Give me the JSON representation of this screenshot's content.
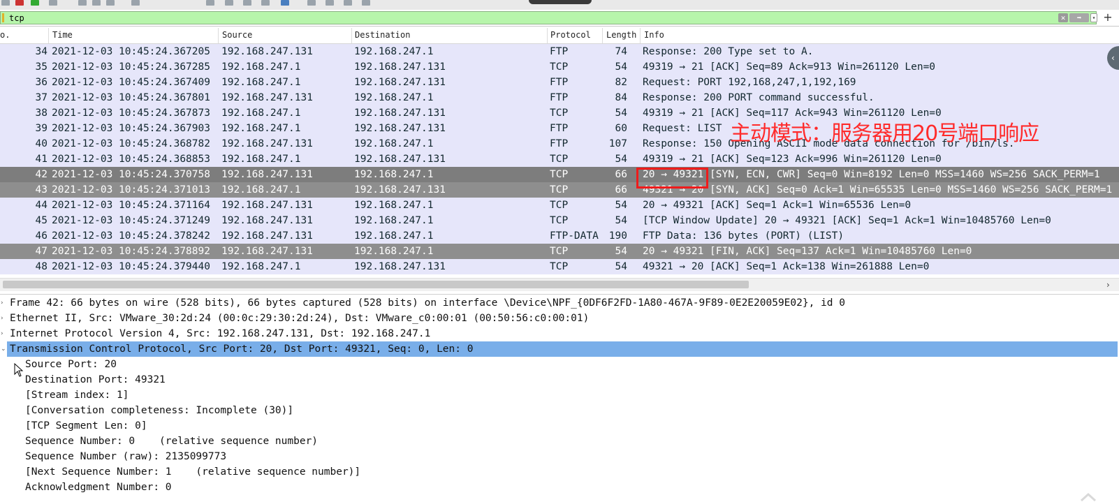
{
  "filter": {
    "value": "tcp"
  },
  "filter_buttons": {
    "clear": "✕",
    "apply": "➡",
    "dropdown": "▾",
    "add": "+"
  },
  "columns": {
    "no": "o.",
    "time": "Time",
    "source": "Source",
    "destination": "Destination",
    "protocol": "Protocol",
    "length": "Length",
    "info": "Info"
  },
  "packets": [
    {
      "no": "34",
      "time": "2021-12-03 10:45:24.367205",
      "src": "192.168.247.131",
      "dst": "192.168.247.1",
      "proto": "FTP",
      "len": "74",
      "info": "Response: 200 Type set to A."
    },
    {
      "no": "35",
      "time": "2021-12-03 10:45:24.367285",
      "src": "192.168.247.1",
      "dst": "192.168.247.131",
      "proto": "TCP",
      "len": "54",
      "info": "49319 → 21 [ACK] Seq=89 Ack=913 Win=261120 Len=0"
    },
    {
      "no": "36",
      "time": "2021-12-03 10:45:24.367409",
      "src": "192.168.247.1",
      "dst": "192.168.247.131",
      "proto": "FTP",
      "len": "82",
      "info": "Request: PORT 192,168,247,1,192,169"
    },
    {
      "no": "37",
      "time": "2021-12-03 10:45:24.367801",
      "src": "192.168.247.131",
      "dst": "192.168.247.1",
      "proto": "FTP",
      "len": "84",
      "info": "Response: 200 PORT command successful."
    },
    {
      "no": "38",
      "time": "2021-12-03 10:45:24.367873",
      "src": "192.168.247.1",
      "dst": "192.168.247.131",
      "proto": "TCP",
      "len": "54",
      "info": "49319 → 21 [ACK] Seq=117 Ack=943 Win=261120 Len=0"
    },
    {
      "no": "39",
      "time": "2021-12-03 10:45:24.367903",
      "src": "192.168.247.1",
      "dst": "192.168.247.131",
      "proto": "FTP",
      "len": "60",
      "info": "Request: LIST"
    },
    {
      "no": "40",
      "time": "2021-12-03 10:45:24.368782",
      "src": "192.168.247.131",
      "dst": "192.168.247.1",
      "proto": "FTP",
      "len": "107",
      "info": "Response: 150 Opening ASCII mode data connection for /bin/ls."
    },
    {
      "no": "41",
      "time": "2021-12-03 10:45:24.368853",
      "src": "192.168.247.1",
      "dst": "192.168.247.131",
      "proto": "TCP",
      "len": "54",
      "info": "49319 → 21 [ACK] Seq=123 Ack=996 Win=261120 Len=0"
    },
    {
      "no": "42",
      "time": "2021-12-03 10:45:24.370758",
      "src": "192.168.247.131",
      "dst": "192.168.247.1",
      "proto": "TCP",
      "len": "66",
      "info": "20 → 49321 [SYN, ECN, CWR] Seq=0 Win=8192 Len=0 MSS=1460 WS=256 SACK_PERM=1"
    },
    {
      "no": "43",
      "time": "2021-12-03 10:45:24.371013",
      "src": "192.168.247.1",
      "dst": "192.168.247.131",
      "proto": "TCP",
      "len": "66",
      "info": "49321 → 20 [SYN, ACK] Seq=0 Ack=1 Win=65535 Len=0 MSS=1460 WS=256 SACK_PERM=1"
    },
    {
      "no": "44",
      "time": "2021-12-03 10:45:24.371164",
      "src": "192.168.247.131",
      "dst": "192.168.247.1",
      "proto": "TCP",
      "len": "54",
      "info": "20 → 49321 [ACK] Seq=1 Ack=1 Win=65536 Len=0"
    },
    {
      "no": "45",
      "time": "2021-12-03 10:45:24.371249",
      "src": "192.168.247.131",
      "dst": "192.168.247.1",
      "proto": "TCP",
      "len": "54",
      "info": "[TCP Window Update] 20 → 49321 [ACK] Seq=1 Ack=1 Win=10485760 Len=0"
    },
    {
      "no": "46",
      "time": "2021-12-03 10:45:24.378242",
      "src": "192.168.247.131",
      "dst": "192.168.247.1",
      "proto": "FTP-DATA",
      "len": "190",
      "info": "FTP Data: 136 bytes (PORT) (LIST)"
    },
    {
      "no": "47",
      "time": "2021-12-03 10:45:24.378892",
      "src": "192.168.247.131",
      "dst": "192.168.247.1",
      "proto": "TCP",
      "len": "54",
      "info": "20 → 49321 [FIN, ACK] Seq=137 Ack=1 Win=10485760 Len=0"
    },
    {
      "no": "48",
      "time": "2021-12-03 10:45:24.379440",
      "src": "192.168.247.1",
      "dst": "192.168.247.131",
      "proto": "TCP",
      "len": "54",
      "info": "49321 → 20 [ACK] Seq=1 Ack=138 Win=261888 Len=0"
    }
  ],
  "annotation": "主动模式：服务器用20号端口响应",
  "details": [
    {
      "text": "Frame 42: 66 bytes on wire (528 bits), 66 bytes captured (528 bits) on interface \\Device\\NPF_{0DF6F2FD-1A80-467A-9F89-0E2E20059E02}, id 0",
      "level": 0,
      "expander": "›"
    },
    {
      "text": "Ethernet II, Src: VMware_30:2d:24 (00:0c:29:30:2d:24), Dst: VMware_c0:00:01 (00:50:56:c0:00:01)",
      "level": 0,
      "expander": "›"
    },
    {
      "text": "Internet Protocol Version 4, Src: 192.168.247.131, Dst: 192.168.247.1",
      "level": 0,
      "expander": "›"
    },
    {
      "text": "Transmission Control Protocol, Src Port: 20, Dst Port: 49321, Seq: 0, Len: 0",
      "level": 0,
      "expander": "⌄"
    },
    {
      "text": "Source Port: 20",
      "level": 1,
      "expander": ""
    },
    {
      "text": "Destination Port: 49321",
      "level": 1,
      "expander": ""
    },
    {
      "text": "[Stream index: 1]",
      "level": 1,
      "expander": ""
    },
    {
      "text": "[Conversation completeness: Incomplete (30)]",
      "level": 1,
      "expander": ""
    },
    {
      "text": "[TCP Segment Len: 0]",
      "level": 1,
      "expander": ""
    },
    {
      "text": "Sequence Number: 0    (relative sequence number)",
      "level": 1,
      "expander": ""
    },
    {
      "text": "Sequence Number (raw): 2135099773",
      "level": 1,
      "expander": ""
    },
    {
      "text": "[Next Sequence Number: 1    (relative sequence number)]",
      "level": 1,
      "expander": ""
    },
    {
      "text": "Acknowledgment Number: 0",
      "level": 1,
      "expander": ""
    }
  ],
  "colors": {
    "filter_valid": "#b7f5ab",
    "row_default": "#e6e6fa",
    "row_selected": "#7d7d7d",
    "row_marked": "#8e8e8e",
    "detail_highlight": "#79aee9",
    "annotation": "#ff2b2b"
  },
  "scroll_arrow": "›",
  "sidetab_glyph": "‹"
}
